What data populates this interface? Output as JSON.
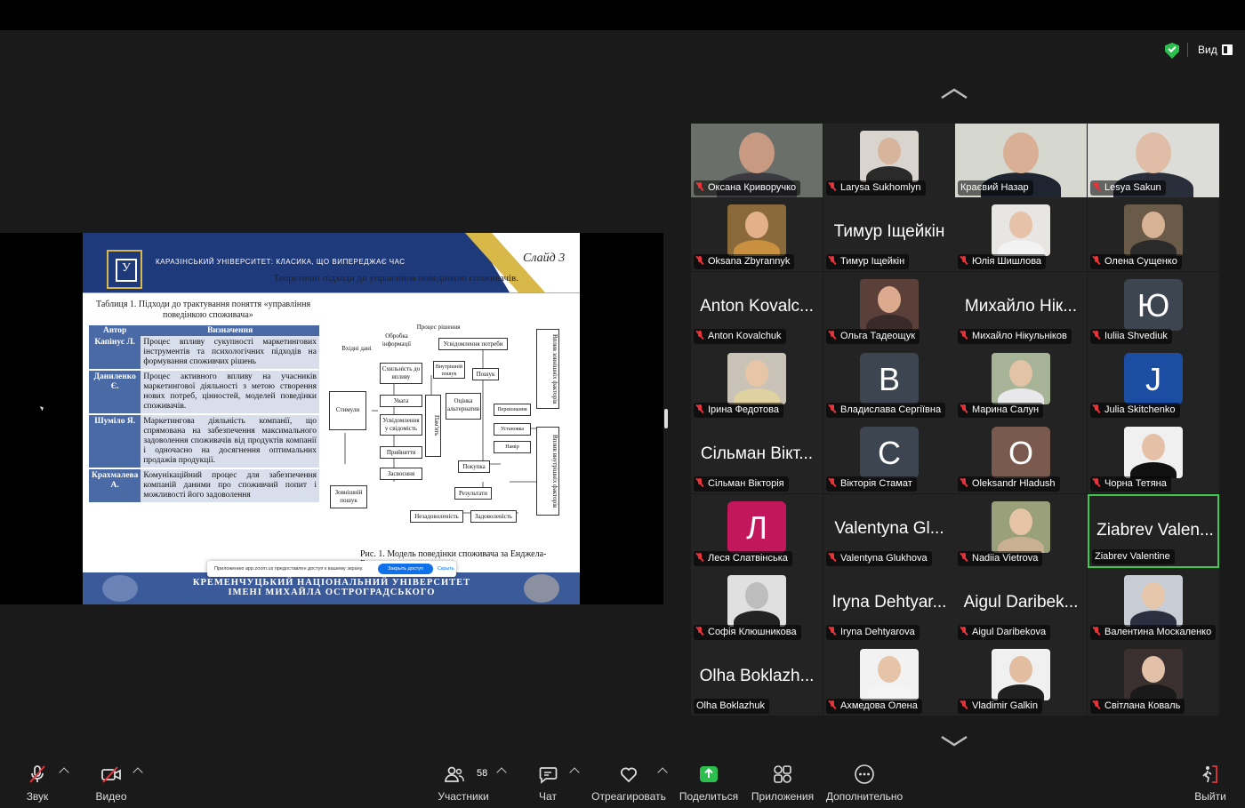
{
  "view_menu": {
    "label": "Вид"
  },
  "slide": {
    "header_text": "КАРАЗІНСЬКИЙ УНІВЕРСИТЕТ: КЛАСИКА, ЩО ВИПЕРЕДЖАЄ ЧАС",
    "slide_number": "Слайд 3",
    "subtitle": "Теоретичні підходи до управління поведінкою споживачів.",
    "table_caption_1": "Таблиця 1. Підходи до трактування поняття «управління",
    "table_caption_2": "поведінкою споживача»",
    "table_headers": [
      "Автор",
      "Визначення"
    ],
    "table_rows": [
      {
        "author": "Капінус Л.",
        "text": "Процес впливу сукупності маркетингових інструментів та психологічних підходів на формування споживчих рішень"
      },
      {
        "author": "Даниленко Є.",
        "text": "Процес активного впливу на учасників маркетингової діяльності з метою створення нових потреб, цінностей, моделей поведінки споживачів."
      },
      {
        "author": "Шуміло Я.",
        "text": "Маркетингова діяльність компанії, що спрямована на забезпечення максимального задоволення споживачів від продуктів компанії і одночасно на досягнення оптимальних продажів продукції."
      },
      {
        "author": "Крахмалева А.",
        "text": "Комунікаційний процес для забезпечення компаній даними про споживчий попит і можливості його задоволення"
      }
    ],
    "diagram": {
      "process_label": "Процес рішення",
      "info_label": "Обробка інформації",
      "input_label": "Вхідні дані",
      "stimuli": "Стимули",
      "search_outer": "Зовнішній пошук",
      "exposure": "Схильність до впливу",
      "attention": "Увага",
      "awareness": "Усвідомлення у свідомість",
      "acceptance": "Прийняття",
      "retention": "Засвоєння",
      "memory": "Пам'ять",
      "need": "Усвідомлення потреби",
      "internal_search": "Внутрішній пошук",
      "search": "Пошук",
      "evaluation": "Оцінка альтернатив",
      "beliefs": "Переконання",
      "attitudes": "Установка",
      "intention": "Намір",
      "purchase": "Покупка",
      "results": "Результати",
      "dissatisfaction": "Незадоволеність",
      "satisfaction": "Задоволеність",
      "external_factors": "Вплив зовнішніх факторів",
      "internal_factors": "Вплив внутрішніх факторів"
    },
    "figure_caption": "Рис. 1. Модель поведінки споживача за Енджела-Блеквелла.",
    "footer_line1": "КРЕМЕНЧУЦЬКИЙ НАЦІОНАЛЬНИЙ УНІВЕРСИТЕТ",
    "footer_line2": "ІМЕНІ МИХАЙЛА ОСТРОГРАДСЬКОГО"
  },
  "share_notice": {
    "text": "Приложению app.zoom.us предоставлен доступ к вашему экрану.",
    "button": "Закрыть доступ",
    "hide": "Скрыть"
  },
  "participants": [
    {
      "name": "Оксана Криворучко",
      "muted": true,
      "kind": "video",
      "bg": "#6a6f6a",
      "skin": "#c89a82",
      "cloth": "#3a3a40"
    },
    {
      "name": "Larysa Sukhomlyn",
      "muted": true,
      "kind": "photo",
      "bg": "#d9d4ce",
      "skin": "#d7b59c",
      "cloth": "#2a2a2a"
    },
    {
      "name": "Краєвий Назар",
      "muted": false,
      "kind": "video",
      "bg": "#d6d8d0",
      "skin": "#d9b096",
      "cloth": "#1e2530"
    },
    {
      "name": "Lesya Sakun",
      "muted": true,
      "kind": "video",
      "bg": "#dcdcd8",
      "skin": "#e0bda6",
      "cloth": "#2a2e3a"
    },
    {
      "name": "Oksana Zbyrannyk",
      "muted": true,
      "kind": "photo",
      "bg": "#8a6a3a",
      "skin": "#e3b08a",
      "cloth": "#c99040"
    },
    {
      "name": "Тимур Іщейкін",
      "muted": true,
      "kind": "text",
      "display": "Тимур Іщейкін"
    },
    {
      "name": "Юлія Шишлова",
      "muted": true,
      "kind": "photo",
      "bg": "#e8e6e2",
      "skin": "#e6c2a8",
      "cloth": "#f2f2f2"
    },
    {
      "name": "Олена Сущенко",
      "muted": true,
      "kind": "photo",
      "bg": "#6a5a48",
      "skin": "#d8b295",
      "cloth": "#2a2a2a"
    },
    {
      "name": "Anton Kovalchuk",
      "muted": true,
      "kind": "text",
      "display": "Anton Kovalc..."
    },
    {
      "name": "Ольга Тадеощук",
      "muted": true,
      "kind": "photo",
      "bg": "#5a4038",
      "skin": "#dcaa8e",
      "cloth": "#3a2a2a"
    },
    {
      "name": "Михайло Нікульніков",
      "muted": true,
      "kind": "text",
      "display": "Михайло Нік..."
    },
    {
      "name": "Iuliia Shvediuk",
      "muted": true,
      "kind": "avatar",
      "letter": "Ю",
      "color": "#3d4550"
    },
    {
      "name": "Ірина Федотова",
      "muted": true,
      "kind": "photo",
      "bg": "#c9c2b6",
      "skin": "#e6c6a6",
      "cloth": "#e0d2a0"
    },
    {
      "name": "Владислава Сергіївна",
      "muted": true,
      "kind": "avatar",
      "letter": "В",
      "color": "#3d4550"
    },
    {
      "name": "Марина Салун",
      "muted": true,
      "kind": "photo",
      "bg": "#a8b498",
      "skin": "#e3c3a6",
      "cloth": "#e8e8ea"
    },
    {
      "name": "Julia Skitchenko",
      "muted": true,
      "kind": "avatar",
      "letter": "J",
      "color": "#1b4ea3"
    },
    {
      "name": "Сільман Вікторія",
      "muted": true,
      "kind": "text",
      "display": "Сільман Вікт..."
    },
    {
      "name": "Вікторія Стамат",
      "muted": true,
      "kind": "avatar",
      "letter": "С",
      "color": "#3d4550"
    },
    {
      "name": "Oleksandr Hladush",
      "muted": true,
      "kind": "avatar",
      "letter": "O",
      "color": "#7a5a4e"
    },
    {
      "name": "Чорна Тетяна",
      "muted": true,
      "kind": "photo",
      "bg": "#f0f0f0",
      "skin": "#e6c0a6",
      "cloth": "#111111"
    },
    {
      "name": "Леся Слатвінська",
      "muted": true,
      "kind": "avatar",
      "letter": "Л",
      "color": "#c2185b"
    },
    {
      "name": "Valentyna Glukhova",
      "muted": true,
      "kind": "text",
      "display": "Valentyna Gl..."
    },
    {
      "name": "Nadiia Vietrova",
      "muted": true,
      "kind": "photo",
      "bg": "#9aa07a",
      "skin": "#e6c4a6",
      "cloth": "#c8b090"
    },
    {
      "name": "Ziabrev Valentine",
      "muted": false,
      "kind": "text",
      "display": "Ziabrev Valen...",
      "active": true
    },
    {
      "name": "Софія Клюшникова",
      "muted": true,
      "kind": "photo",
      "bg": "#e0e0e0",
      "skin": "#bdbdbd",
      "cloth": "#222222"
    },
    {
      "name": "Iryna Dehtyarova",
      "muted": true,
      "kind": "text",
      "display": "Iryna Dehtyar..."
    },
    {
      "name": "Aigul Daribekova",
      "muted": true,
      "kind": "text",
      "display": "Aigul Daribek..."
    },
    {
      "name": "Валентина Москаленко",
      "muted": true,
      "kind": "photo",
      "bg": "#c8ccd4",
      "skin": "#e6c6aa",
      "cloth": "#2a3040"
    },
    {
      "name": "Olha Boklazhuk",
      "muted": false,
      "kind": "text",
      "display": "Olha Boklazh..."
    },
    {
      "name": "Ахмедова Олена",
      "muted": true,
      "kind": "photo",
      "bg": "#f2f2f2",
      "skin": "#e6c4a8",
      "cloth": "#f5f5f5"
    },
    {
      "name": "Vladimir Galkin",
      "muted": true,
      "kind": "photo",
      "bg": "#f0f0f0",
      "skin": "#e2bda0",
      "cloth": "#202020"
    },
    {
      "name": "Світлана Коваль",
      "muted": true,
      "kind": "photo",
      "bg": "#3a3030",
      "skin": "#e3c0a8",
      "cloth": "#1a1a1a"
    }
  ],
  "toolbar": {
    "audio": "Звук",
    "video": "Видео",
    "participants": "Участники",
    "participants_count": "58",
    "chat": "Чат",
    "react": "Отреагировать",
    "share": "Поделиться",
    "apps": "Приложения",
    "more": "Дополнительно",
    "leave": "Выйти"
  },
  "colors": {
    "accent_green": "#3ec94f",
    "share_green": "#2dbf4e",
    "muted_red": "#e5343a",
    "leave_red": "#e5343a"
  }
}
